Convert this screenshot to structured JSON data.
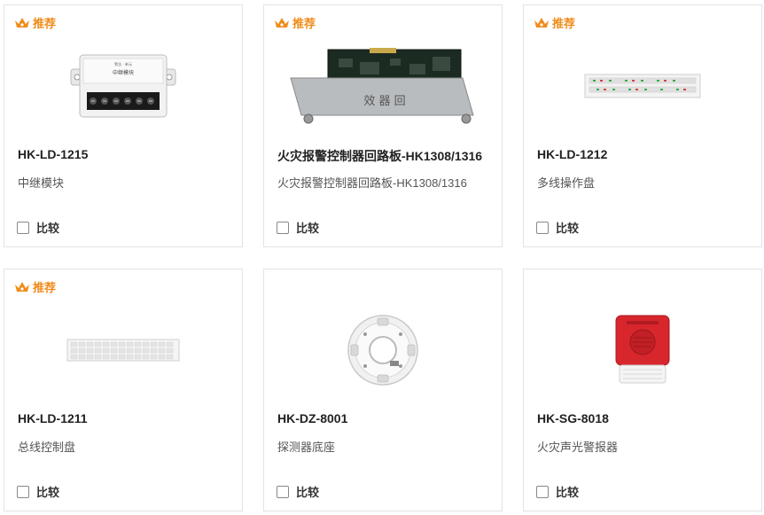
{
  "recommend_label": "推荐",
  "compare_label": "比较",
  "accent_color": "#f08c1b",
  "products": [
    {
      "model": "HK-LD-1215",
      "desc": "中继模块",
      "recommended": true,
      "image": "relay-module-image"
    },
    {
      "model": "火灾报警控制器回路板-HK1308/1316",
      "desc": "火灾报警控制器回路板-HK1308/1316",
      "recommended": true,
      "image": "loop-board-image"
    },
    {
      "model": "HK-LD-1212",
      "desc": "多线操作盘",
      "recommended": true,
      "image": "multi-line-panel-image"
    },
    {
      "model": "HK-LD-1211",
      "desc": "总线控制盘",
      "recommended": true,
      "image": "bus-control-panel-image"
    },
    {
      "model": "HK-DZ-8001",
      "desc": "探测器底座",
      "recommended": false,
      "image": "detector-base-image"
    },
    {
      "model": "HK-SG-8018",
      "desc": "火灾声光警报器",
      "recommended": false,
      "image": "sound-light-alarm-image"
    }
  ],
  "images": {
    "relay_module_title": "中继模块",
    "loop_board_panel_text": "效 器 回"
  }
}
